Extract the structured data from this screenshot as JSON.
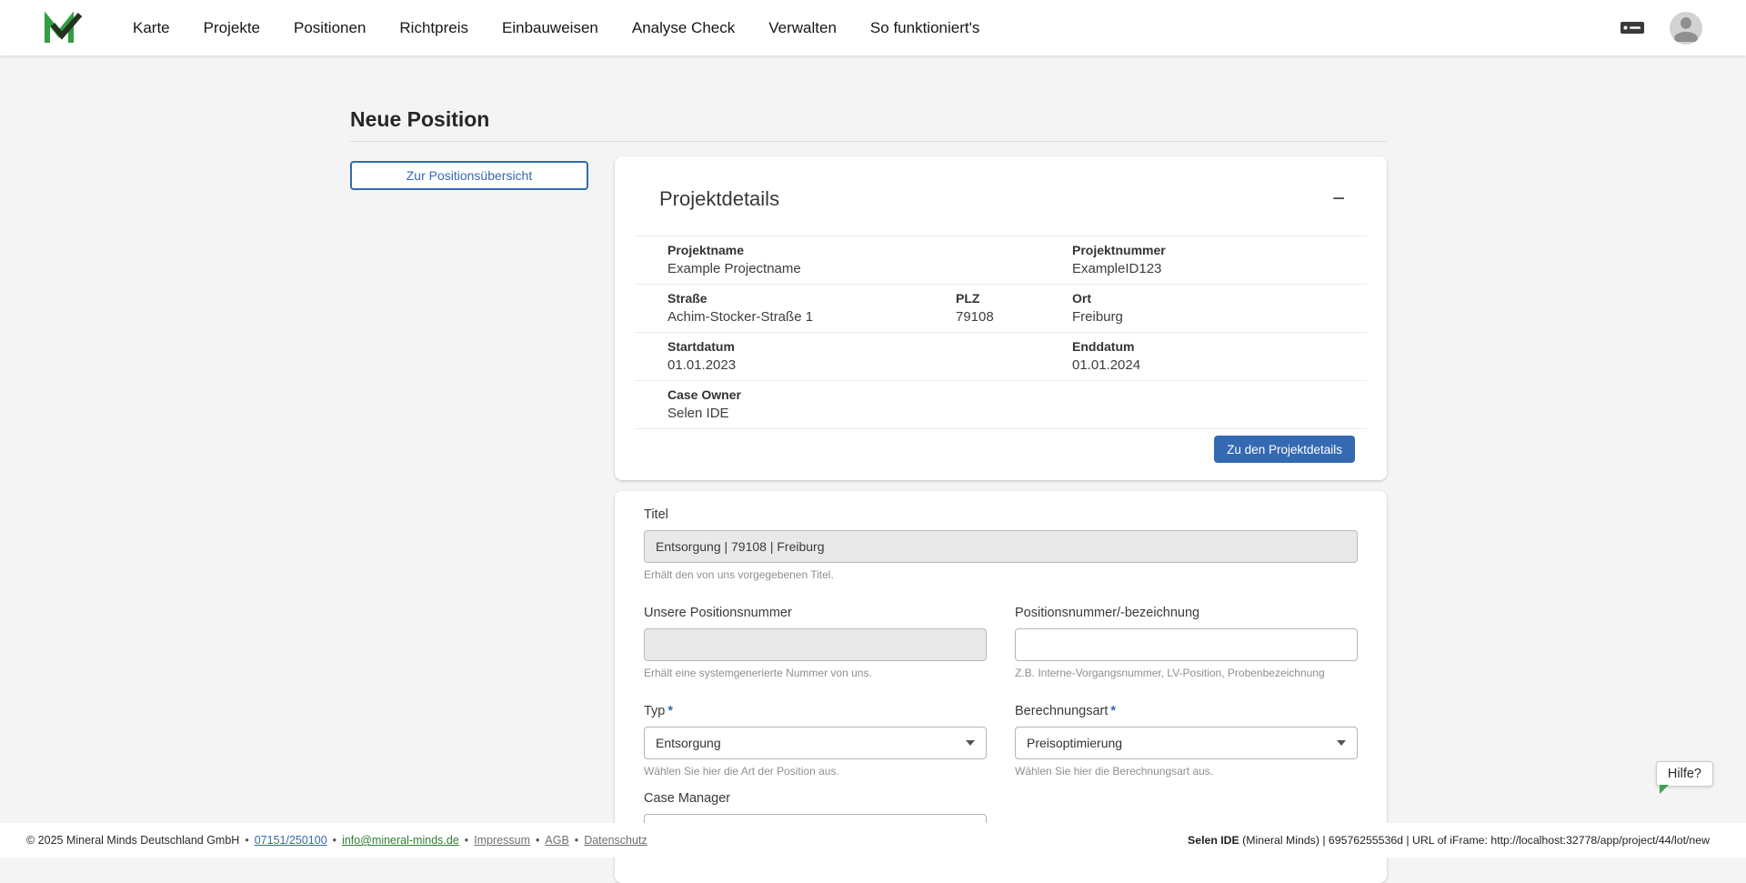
{
  "nav": {
    "items": [
      "Karte",
      "Projekte",
      "Positionen",
      "Richtpreis",
      "Einbauweisen",
      "Analyse Check",
      "Verwalten",
      "So funktioniert's"
    ]
  },
  "page": {
    "title": "Neue Position",
    "back_button": "Zur Positionsübersicht"
  },
  "project_details": {
    "title": "Projektdetails",
    "collapse_icon": "−",
    "projektname": {
      "label": "Projektname",
      "value": "Example Projectname"
    },
    "projektnummer": {
      "label": "Projektnummer",
      "value": "ExampleID123"
    },
    "strasse": {
      "label": "Straße",
      "value": "Achim-Stocker-Straße 1"
    },
    "plz": {
      "label": "PLZ",
      "value": "79108"
    },
    "ort": {
      "label": "Ort",
      "value": "Freiburg"
    },
    "startdatum": {
      "label": "Startdatum",
      "value": "01.01.2023"
    },
    "enddatum": {
      "label": "Enddatum",
      "value": "01.01.2024"
    },
    "case_owner": {
      "label": "Case Owner",
      "value": "Selen IDE"
    },
    "details_button": "Zu den Projektdetails"
  },
  "form": {
    "titel_label": "Titel",
    "titel_value": "Entsorgung | 79108 | Freiburg",
    "titel_helper": "Erhält den von uns vorgegebenen Titel.",
    "unsere_positionsnummer_label": "Unsere Positionsnummer",
    "unsere_positionsnummer_value": "",
    "unsere_positionsnummer_helper": "Erhält eine systemgenerierte Nummer von uns.",
    "positionsnummer_label": "Positionsnummer/-bezeichnung",
    "positionsnummer_value": "",
    "positionsnummer_helper": "Z.B. Interne-Vorgangsnummer, LV-Position, Probenbezeichnung",
    "typ_label": "Typ",
    "typ_value": "Entsorgung",
    "typ_helper": "Wählen Sie hier die Art der Position aus.",
    "berechnungsart_label": "Berechnungsart",
    "berechnungsart_value": "Preisoptimierung",
    "berechnungsart_helper": "Wählen Sie hier die Berechnungsart aus.",
    "case_manager_label": "Case Manager",
    "required_marker": "*"
  },
  "help": {
    "label": "Hilfe?"
  },
  "footer": {
    "copyright": "© 2025 Mineral Minds Deutschland GmbH",
    "separator": "•",
    "links": [
      {
        "label": "07151/250100"
      },
      {
        "label": "info@mineral-minds.de"
      },
      {
        "label": "Impressum"
      },
      {
        "label": "AGB"
      },
      {
        "label": "Datenschutz"
      }
    ],
    "session_user": "Selen IDE",
    "session_info": " (Mineral Minds) | 69576255536d | URL of iFrame: http://localhost:32778/app/project/44/lot/new"
  },
  "colors": {
    "primary_blue": "#3569b1",
    "logo_green": "#2f9e44",
    "help_green": "#3aa14e",
    "email_green": "#2e7d32",
    "background_gray": "#f4f4f4"
  }
}
